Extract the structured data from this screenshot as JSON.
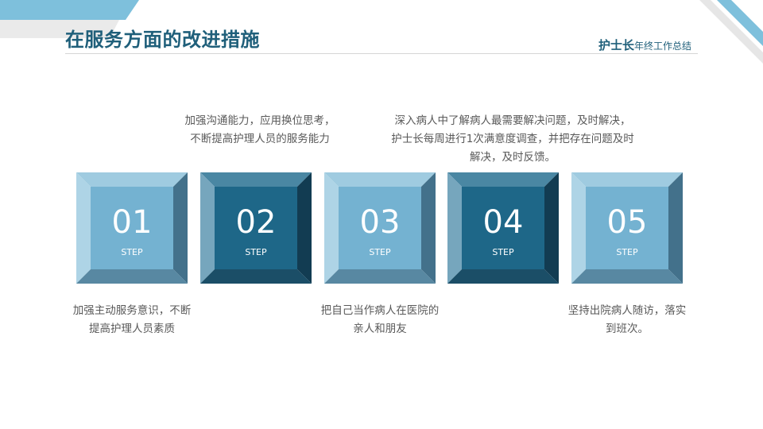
{
  "header": {
    "title": "在服务方面的改进措施",
    "brand_strong": "护士长",
    "brand_rest": "年终工作总结"
  },
  "steps": [
    {
      "number": "01",
      "label": "STEP",
      "text": "加强主动服务意识，不断提高护理人员素质"
    },
    {
      "number": "02",
      "label": "STEP",
      "text": "加强沟通能力，应用换位思考，不断提高护理人员的服务能力"
    },
    {
      "number": "03",
      "label": "STEP",
      "text": "把自己当作病人在医院的亲人和朋友"
    },
    {
      "number": "04",
      "label": "STEP",
      "text": "深入病人中了解病人最需要解决问题，及时解决，护士长每周进行1次满意度调查，并把存在问题及时解决，及时反馈。"
    },
    {
      "number": "05",
      "label": "STEP",
      "text": "坚持出院病人随访，落实到班次。"
    }
  ],
  "colors": {
    "title": "#1f5f7a",
    "light_face": "#74b2d1",
    "dark_face": "#1e6788",
    "accent": "#7ec0dc"
  }
}
